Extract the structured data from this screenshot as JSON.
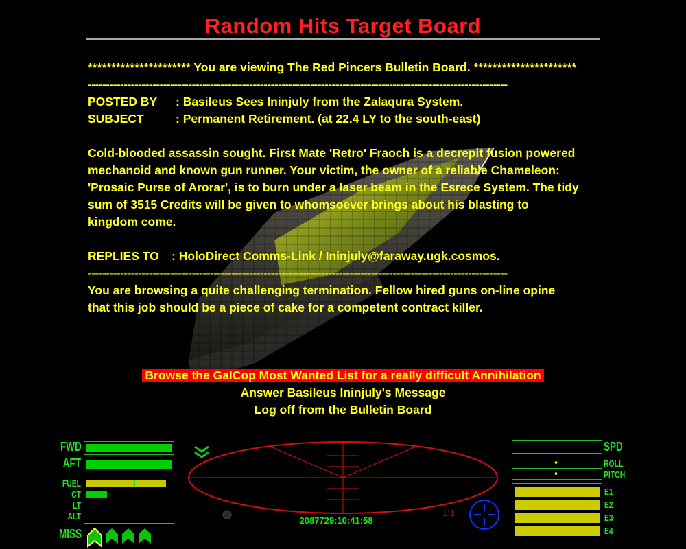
{
  "title": "Random Hits Target Board",
  "board": {
    "header": "********************** You are viewing The Red Pincers Bulletin Board. **********************",
    "separator": "---------------------------------------------------------------------------------------------------------------------",
    "posted_by_label": "POSTED BY",
    "posted_by_value": ": Basileus Sees Ininjuly from the Zalaqura System.",
    "subject_label": "SUBJECT",
    "subject_value": ": Permanent Retirement. (at 22.4 LY to the south-east)",
    "body_lines": [
      "Cold-blooded assassin sought. First Mate 'Retro' Fraoch is a decrepit fusion powered",
      "mechanoid and known gun runner. Your victim, the owner of a reliable Chameleon:",
      "'Prosaic Purse of Arorar', is to burn under a laser beam in the Esrece System. The tidy",
      "sum of 3515 Credits will be given to whomsoever brings about his blasting to",
      "kingdom come."
    ],
    "replies_label": "REPLIES TO",
    "replies_value": ": HoloDirect Comms-Link / Ininjuly@faraway.ugk.cosmos.",
    "footer_lines": [
      "You are browsing a quite challenging termination. Fellow hired guns on-line opine",
      "that this job should be a piece of cake for a competent contract killer."
    ]
  },
  "menu": [
    {
      "label": "Browse the GalCop Most Wanted List for a really difficult Annihilation",
      "selected": true
    },
    {
      "label": "Answer Basileus Ininjuly's Message",
      "selected": false
    },
    {
      "label": "Log off from the Bulletin Board",
      "selected": false
    }
  ],
  "hud": {
    "fwd_label": "FWD",
    "aft_label": "AFT",
    "fwd_shield": 1.0,
    "aft_shield": 1.0,
    "fuel_label": "FUEL",
    "ct_label": "CT",
    "lt_label": "LT",
    "alt_label": "ALT",
    "fuel_level": 0.98,
    "cabin_temp": 0.25,
    "laser_temp": 0.0,
    "altitude": 0.0,
    "miss_label": "MISS",
    "missiles": [
      "missile-icon",
      "missile-icon",
      "missile-icon",
      "missile-icon"
    ],
    "spd_label": "SPD",
    "roll_label": "ROLL",
    "pitch_label": "PITCH",
    "speed": 0.0,
    "energy_labels": [
      "E1",
      "E2",
      "E3",
      "E4"
    ],
    "energy_levels": [
      1.0,
      1.0,
      1.0,
      1.0
    ],
    "clock": "2087729:10:41:58",
    "zoom": "1:1",
    "colors": {
      "hud_green": "#20e020",
      "text_yellow": "#ffff20",
      "title_red": "#ff2020",
      "energy_yellow": "#cccc00",
      "scanner_red": "#d01010",
      "compass_blue": "#1030ff"
    }
  }
}
